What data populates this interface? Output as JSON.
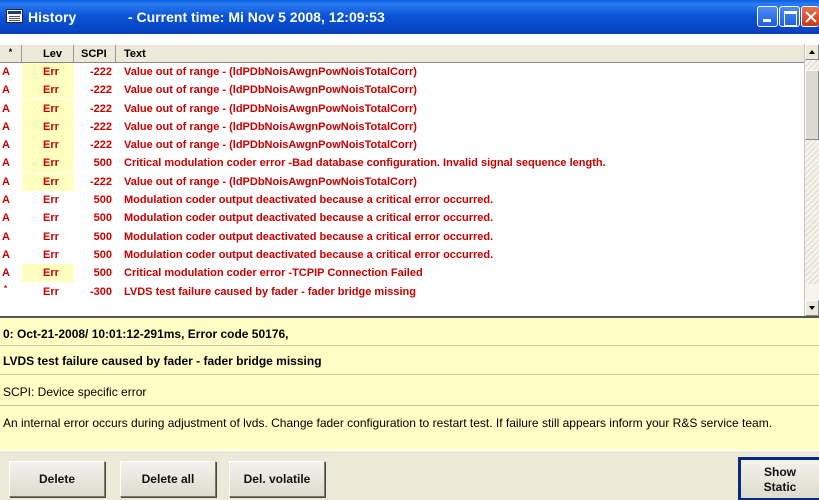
{
  "window": {
    "app_title": "History",
    "current_time_label": "- Current time:  Mi Nov 5 2008,   12:09:53"
  },
  "table": {
    "headers": {
      "marker": "*",
      "level": "Lev",
      "scpi": "SCPI",
      "text": "Text"
    },
    "rows": [
      {
        "marker": "A",
        "level": "Err",
        "scpi": "-222",
        "text": "Value out of range - (ldPDbNoisAwgnPowNoisTotalCorr)",
        "highlight": true
      },
      {
        "marker": "A",
        "level": "Err",
        "scpi": "-222",
        "text": "Value out of range - (ldPDbNoisAwgnPowNoisTotalCorr)",
        "highlight": true
      },
      {
        "marker": "A",
        "level": "Err",
        "scpi": "-222",
        "text": "Value out of range - (ldPDbNoisAwgnPowNoisTotalCorr)",
        "highlight": true
      },
      {
        "marker": "A",
        "level": "Err",
        "scpi": "-222",
        "text": "Value out of range - (ldPDbNoisAwgnPowNoisTotalCorr)",
        "highlight": true
      },
      {
        "marker": "A",
        "level": "Err",
        "scpi": "-222",
        "text": "Value out of range - (ldPDbNoisAwgnPowNoisTotalCorr)",
        "highlight": true
      },
      {
        "marker": "A",
        "level": "Err",
        "scpi": "500",
        "text": "Critical modulation coder error -Bad database configuration. Invalid signal sequence length.",
        "highlight": true
      },
      {
        "marker": "A",
        "level": "Err",
        "scpi": "-222",
        "text": "Value out of range - (ldPDbNoisAwgnPowNoisTotalCorr)",
        "highlight": true
      },
      {
        "marker": "A",
        "level": "Err",
        "scpi": "500",
        "text": "Modulation coder output deactivated because a critical error occurred.",
        "highlight": false
      },
      {
        "marker": "A",
        "level": "Err",
        "scpi": "500",
        "text": "Modulation coder output deactivated because a critical error occurred.",
        "highlight": false
      },
      {
        "marker": "A",
        "level": "Err",
        "scpi": "500",
        "text": "Modulation coder output deactivated because a critical error occurred.",
        "highlight": false
      },
      {
        "marker": "A",
        "level": "Err",
        "scpi": "500",
        "text": "Modulation coder output deactivated because a critical error occurred.",
        "highlight": false
      },
      {
        "marker": "A",
        "level": "Err",
        "scpi": "500",
        "text": "Critical modulation coder error -TCPIP Connection Failed",
        "highlight": true
      },
      {
        "marker": "*",
        "level": "Err",
        "scpi": "-300",
        "text": "LVDS test failure caused by fader - fader bridge missing",
        "highlight": false
      }
    ]
  },
  "detail": {
    "header": "0: Oct-21-2008/ 10:01:12-291ms, Error code 50176,",
    "title": "LVDS test failure caused by fader - fader bridge missing",
    "scpi": "SCPI: Device specific error",
    "description": "An internal error occurs during adjustment of lvds. Change fader configuration to restart test. If failure still appears inform your R&S service team."
  },
  "buttons": {
    "delete": "Delete",
    "delete_all": "Delete all",
    "del_volatile": "Del. volatile",
    "show_static_line1": "Show",
    "show_static_line2": "Static"
  },
  "colors": {
    "error_text": "#cc0000",
    "level_highlight": "#ffffc0",
    "detail_background": "#fffec4",
    "titlebar_blue": "#0b55d8"
  },
  "icons": {
    "title": "history-window-icon",
    "scroll_up": "arrow-up-icon",
    "scroll_down": "arrow-down-icon"
  }
}
